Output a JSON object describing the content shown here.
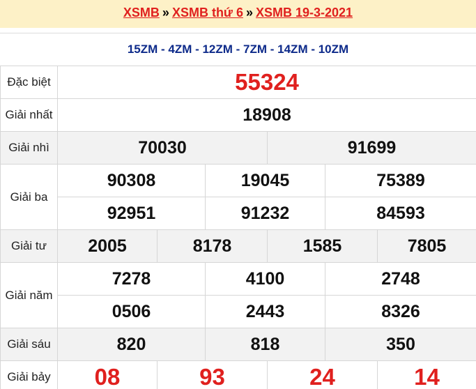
{
  "breadcrumb": {
    "link1": "XSMB",
    "sep1": "»",
    "link2": "XSMB thứ 6",
    "sep2": "»",
    "link3": "XSMB 19-3-2021"
  },
  "codes": "15ZM - 4ZM - 12ZM - 7ZM - 14ZM - 10ZM",
  "prizes": {
    "special": {
      "label": "Đặc biệt",
      "numbers": [
        "55324"
      ]
    },
    "first": {
      "label": "Giải nhất",
      "numbers": [
        "18908"
      ]
    },
    "second": {
      "label": "Giải nhì",
      "numbers": [
        "70030",
        "91699"
      ]
    },
    "third": {
      "label": "Giải ba",
      "numbers": [
        "90308",
        "19045",
        "75389",
        "92951",
        "91232",
        "84593"
      ]
    },
    "fourth": {
      "label": "Giải tư",
      "numbers": [
        "2005",
        "8178",
        "1585",
        "7805"
      ]
    },
    "fifth": {
      "label": "Giải năm",
      "numbers": [
        "7278",
        "4100",
        "2748",
        "0506",
        "2443",
        "8326"
      ]
    },
    "sixth": {
      "label": "Giải sáu",
      "numbers": [
        "820",
        "818",
        "350"
      ]
    },
    "seventh": {
      "label": "Giải bảy",
      "numbers": [
        "08",
        "93",
        "24",
        "14"
      ]
    }
  },
  "colors": {
    "accent_red": "#e0201e",
    "code_blue": "#0d2a8a",
    "header_bg": "#fdf1c7",
    "row_shade": "#f2f2f2"
  }
}
